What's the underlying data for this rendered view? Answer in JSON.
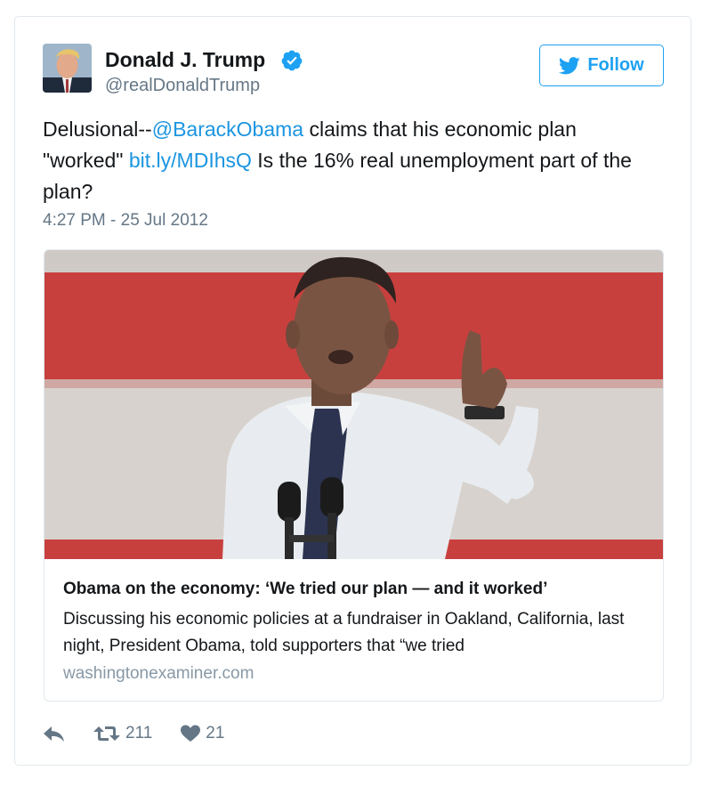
{
  "tweet": {
    "author_name": "Donald J. Trump",
    "author_handle": "@realDonaldTrump",
    "follow_label": "Follow",
    "text_prefix": "Delusional--",
    "mention": "@BarackObama",
    "text_middle": " claims that his economic plan \"worked\" ",
    "link": "bit.ly/MDIhsQ",
    "text_suffix": " Is the 16% real unemployment part of the plan?",
    "timestamp": "4:27 PM - 25 Jul 2012"
  },
  "link_card": {
    "title": "Obama on the economy: ‘We tried our plan — and it worked’",
    "description": "Discussing his economic policies at a fundraiser in Oakland, California, last night, President Obama, told supporters that “we tried",
    "domain": "washingtonexaminer.com"
  },
  "actions": {
    "retweet_count": "211",
    "like_count": "21"
  },
  "icons": {
    "verified": "verified-badge-icon",
    "follow": "twitter-bird-icon",
    "reply": "reply-icon",
    "retweet": "retweet-icon",
    "like": "heart-icon"
  },
  "colors": {
    "link_blue": "#1b95e0",
    "follow_blue": "#1da1f2",
    "muted": "#657786"
  }
}
